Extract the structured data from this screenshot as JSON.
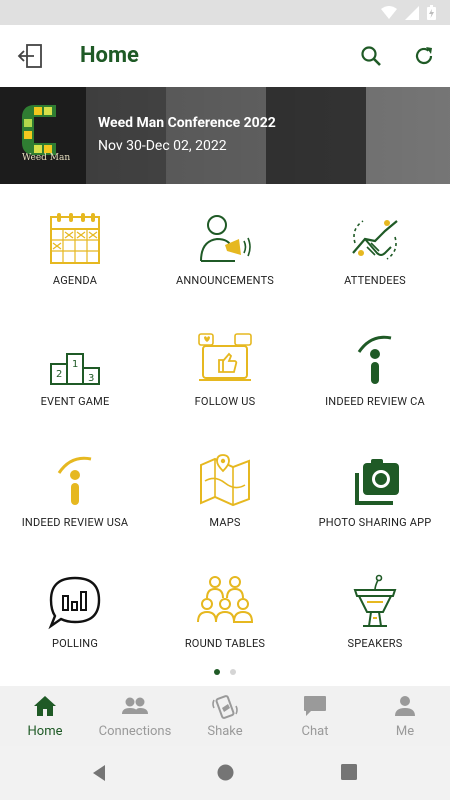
{
  "status_bar": {
    "icons": [
      "wifi-icon",
      "signal-icon",
      "battery-icon"
    ]
  },
  "app_bar": {
    "title": "Home",
    "left_icon": "logout-icon",
    "right_icons": [
      "search-icon",
      "refresh-icon"
    ]
  },
  "banner": {
    "logo_text": "Weed Man",
    "title": "Weed Man Conference 2022",
    "dates": "Nov 30-Dec 02, 2022"
  },
  "grid": {
    "items": [
      {
        "label": "AGENDA",
        "icon": "calendar-icon"
      },
      {
        "label": "ANNOUNCEMENTS",
        "icon": "megaphone-icon"
      },
      {
        "label": "ATTENDEES",
        "icon": "handshake-icon"
      },
      {
        "label": "EVENT GAME",
        "icon": "podium-icon"
      },
      {
        "label": "FOLLOW US",
        "icon": "social-media-icon"
      },
      {
        "label": "INDEED REVIEW CA",
        "icon": "indeed-icon"
      },
      {
        "label": "INDEED REVIEW USA",
        "icon": "indeed-icon"
      },
      {
        "label": "MAPS",
        "icon": "map-icon"
      },
      {
        "label": "PHOTO SHARING APP",
        "icon": "photo-icon"
      },
      {
        "label": "POLLING",
        "icon": "poll-icon"
      },
      {
        "label": "ROUND TABLES",
        "icon": "group-icon"
      },
      {
        "label": "SPEAKERS",
        "icon": "lectern-icon"
      }
    ]
  },
  "pager": {
    "current": 1,
    "total": 2
  },
  "tabs": [
    {
      "label": "Home",
      "icon": "home-icon",
      "active": true
    },
    {
      "label": "Connections",
      "icon": "people-icon",
      "active": false
    },
    {
      "label": "Shake",
      "icon": "shake-icon",
      "active": false
    },
    {
      "label": "Chat",
      "icon": "chat-icon",
      "active": false
    },
    {
      "label": "Me",
      "icon": "person-icon",
      "active": false
    }
  ],
  "colors": {
    "brand_green": "#1f5a26",
    "accent_gold": "#e6b820",
    "tab_inactive": "#9a9a9a"
  }
}
